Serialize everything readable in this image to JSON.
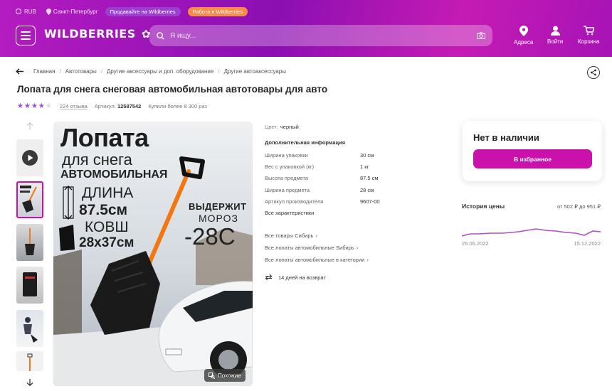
{
  "header": {
    "currency": "RUB",
    "city": "Санкт-Петербург",
    "promo1": "Продавайте на Wildberries",
    "promo2": "Работа в Wildberries",
    "logo": "WILDBERRIES",
    "search_placeholder": "Я ищу...",
    "nav": [
      {
        "label": "Адреса",
        "icon": "map-pin-icon"
      },
      {
        "label": "Войти",
        "icon": "user-icon"
      },
      {
        "label": "Корзина",
        "icon": "cart-icon"
      }
    ]
  },
  "breadcrumbs": [
    "Главная",
    "Автотовары",
    "Другие аксессуары и доп. оборудование",
    "Другие автоаксессуары"
  ],
  "product": {
    "title": "Лопата для снега снеговая автомобильная автотовары для авто",
    "rating": 4,
    "reviews": "224 отзыва",
    "article_label": "Артикул:",
    "article": "12587542",
    "bought": "Купили более 8 300 раз"
  },
  "image_text": {
    "line1": "Лопата",
    "line2": "для снега",
    "line3": "АВТОМОБИЛЬНАЯ",
    "line4": "ДЛИНА",
    "line5": "87.5см",
    "line6": "КОВШ",
    "line7": "28x37см",
    "line8": "ВЫДЕРЖИТ",
    "line9": "МОРОЗ",
    "line10": "-28С",
    "similar": "Похожие"
  },
  "details": {
    "color_label": "Цвет:",
    "color": "черный",
    "section": "Дополнительная информация",
    "rows": [
      {
        "k": "Ширина упаковки",
        "v": "30 см"
      },
      {
        "k": "Вес с упаковкой (кг)",
        "v": "1 кг"
      },
      {
        "k": "Высота предмета",
        "v": "87.5 см"
      },
      {
        "k": "Ширина предмета",
        "v": "28 см"
      },
      {
        "k": "Артикул производителя",
        "v": "9607-00"
      }
    ],
    "all_specs": "Все характеристики",
    "links": [
      "Все товары Сибирь",
      "Все лопаты автомобильные Sибирь",
      "Все лопаты автомобильные в категории"
    ],
    "return": "14 дней на возврат"
  },
  "card": {
    "status": "Нет в наличии",
    "fav_button": "В избранное"
  },
  "price_history": {
    "title": "История цены",
    "from": "от 502 ₽",
    "to_word": "до",
    "to": "951 ₽",
    "date_start": "26.06.2022",
    "date_end": "15.12.2022"
  },
  "colors": {
    "brand": "#cb11ab",
    "line": "#b04fc4"
  }
}
